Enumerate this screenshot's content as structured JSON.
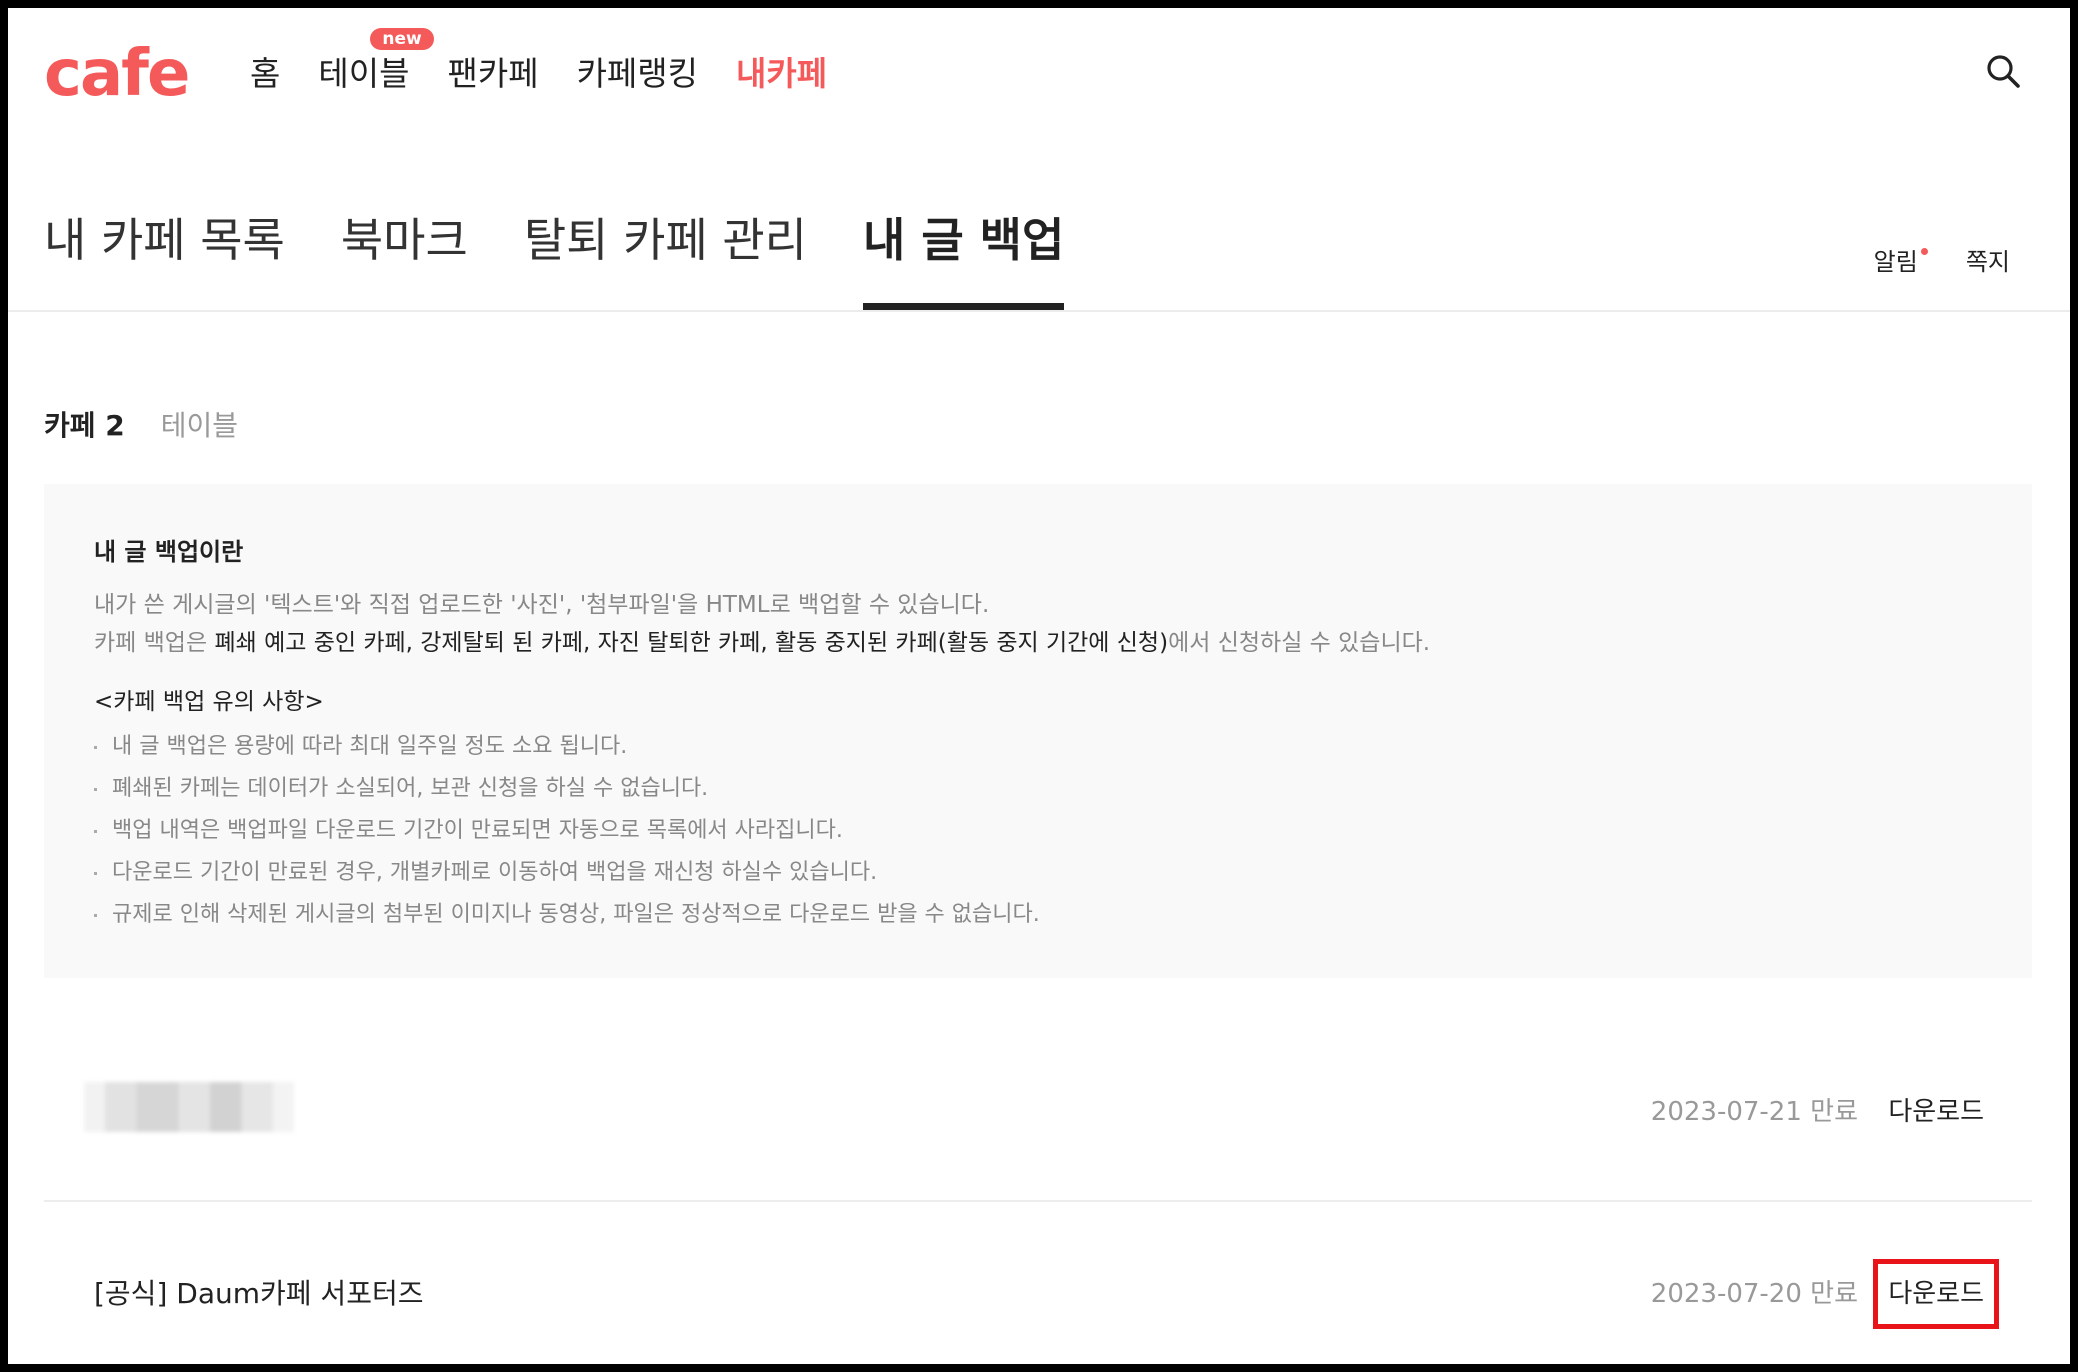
{
  "header": {
    "logo": "cafe",
    "nav": [
      {
        "label": "홈"
      },
      {
        "label": "테이블",
        "badge": "new"
      },
      {
        "label": "팬카페"
      },
      {
        "label": "카페랭킹"
      },
      {
        "label": "내카페",
        "active": true
      }
    ]
  },
  "tabs": [
    {
      "label": "내 카페 목록"
    },
    {
      "label": "북마크"
    },
    {
      "label": "탈퇴 카페 관리"
    },
    {
      "label": "내 글 백업",
      "active": true
    }
  ],
  "utils": {
    "alarm": "알림",
    "message": "쪽지"
  },
  "filter": {
    "active": "카페 2",
    "other": "테이블"
  },
  "info": {
    "title": "내 글 백업이란",
    "line1": "내가 쓴 게시글의 '텍스트'와 직접 업로드한 '사진', '첨부파일'을 HTML로 백업할 수 있습니다.",
    "line2_prefix": "카페 백업은 ",
    "line2_strong": "폐쇄 예고 중인 카페, 강제탈퇴 된 카페, 자진 탈퇴한 카페, 활동 중지된 카페(활동 중지 기간에 신청)",
    "line2_suffix": "에서 신청하실 수 있습니다.",
    "notice_title": "<카페 백업 유의 사항>",
    "notices": [
      "내 글 백업은 용량에 따라 최대 일주일 정도 소요 됩니다.",
      "폐쇄된 카페는 데이터가 소실되어, 보관 신청을 하실 수 없습니다.",
      "백업 내역은 백업파일 다운로드 기간이 만료되면 자동으로 목록에서 사라집니다.",
      "다운로드 기간이 만료된 경우, 개별카페로 이동하여 백업을 재신청 하실수 있습니다.",
      "규제로 인해 삭제된 게시글의 첨부된 이미지나 동영상, 파일은 정상적으로 다운로드 받을 수 없습니다."
    ]
  },
  "backups": [
    {
      "name": "",
      "date": "2023-07-21 만료",
      "download": "다운로드"
    },
    {
      "name": "[공식] Daum카페 서포터즈",
      "date": "2023-07-20 만료",
      "download": "다운로드"
    }
  ],
  "colors": {
    "accent": "#f55a5a",
    "highlight": "#e8141a"
  }
}
